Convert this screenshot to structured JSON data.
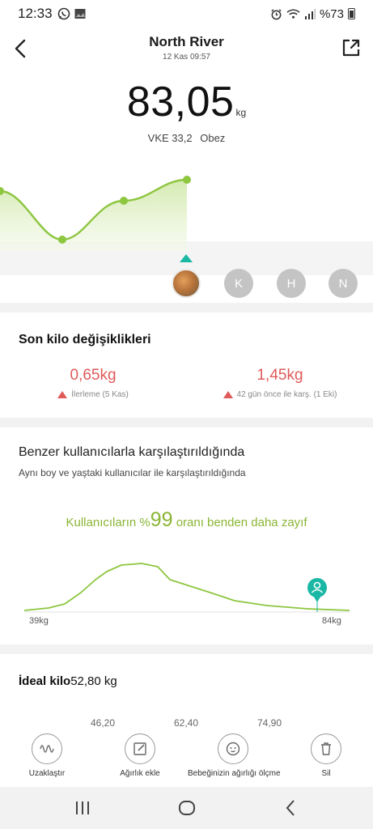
{
  "status_bar": {
    "time": "12:33",
    "left_icons": [
      "whatsapp-icon",
      "gallery-icon"
    ],
    "right_icons": [
      "alarm-icon",
      "wifi-icon",
      "signal-icon"
    ],
    "battery": "%73"
  },
  "header": {
    "title": "North River",
    "subtitle": "12 Kas 09:57"
  },
  "weight": {
    "value": "83,05",
    "unit": "kg",
    "bmi": "VKE 33,2",
    "category": "Obez"
  },
  "trend_chart": {
    "type": "line",
    "accent_color": "#8dc63f",
    "points": [
      0.58,
      0.1,
      0.75,
      1.0
    ],
    "note": ""
  },
  "users": [
    {
      "type": "photo",
      "letter": ""
    },
    {
      "type": "letter",
      "letter": "K"
    },
    {
      "type": "letter",
      "letter": "H"
    },
    {
      "type": "letter",
      "letter": "N"
    }
  ],
  "changes": {
    "title": "Son kilo değişiklikleri",
    "items": [
      {
        "value": "0,65kg",
        "desc": "İlerleme (5 Kas)"
      },
      {
        "value": "1,45kg",
        "desc": "42 gün önce ile karş. (1 Eki)"
      }
    ]
  },
  "comparison": {
    "title": "Benzer kullanıcılarla karşılaştırıldığında",
    "subtitle": "Aynı boy ve yaştaki kullanıcılar ile karşılaştırıldığında",
    "pre": "Kullanıcıların %",
    "percent": "99",
    "post": " oranı benden daha zayıf",
    "min_label": "39kg",
    "max_label": "84kg"
  },
  "ideal": {
    "label": "İdeal kilo",
    "value": "52,80 kg",
    "ticks": [
      "46,20",
      "62,40",
      "74,90"
    ]
  },
  "actions": [
    {
      "label": "Uzaklaştır",
      "icon": "wave-icon"
    },
    {
      "label": "Ağırlık ekle",
      "icon": "edit-icon"
    },
    {
      "label": "Bebeğinizin ağırlığı ölçme",
      "icon": "baby-icon"
    },
    {
      "label": "Sil",
      "icon": "trash-icon"
    }
  ],
  "colors": {
    "accent_green": "#8dc63f",
    "teal": "#1ab7a4",
    "increase_red": "#e05a5a"
  }
}
